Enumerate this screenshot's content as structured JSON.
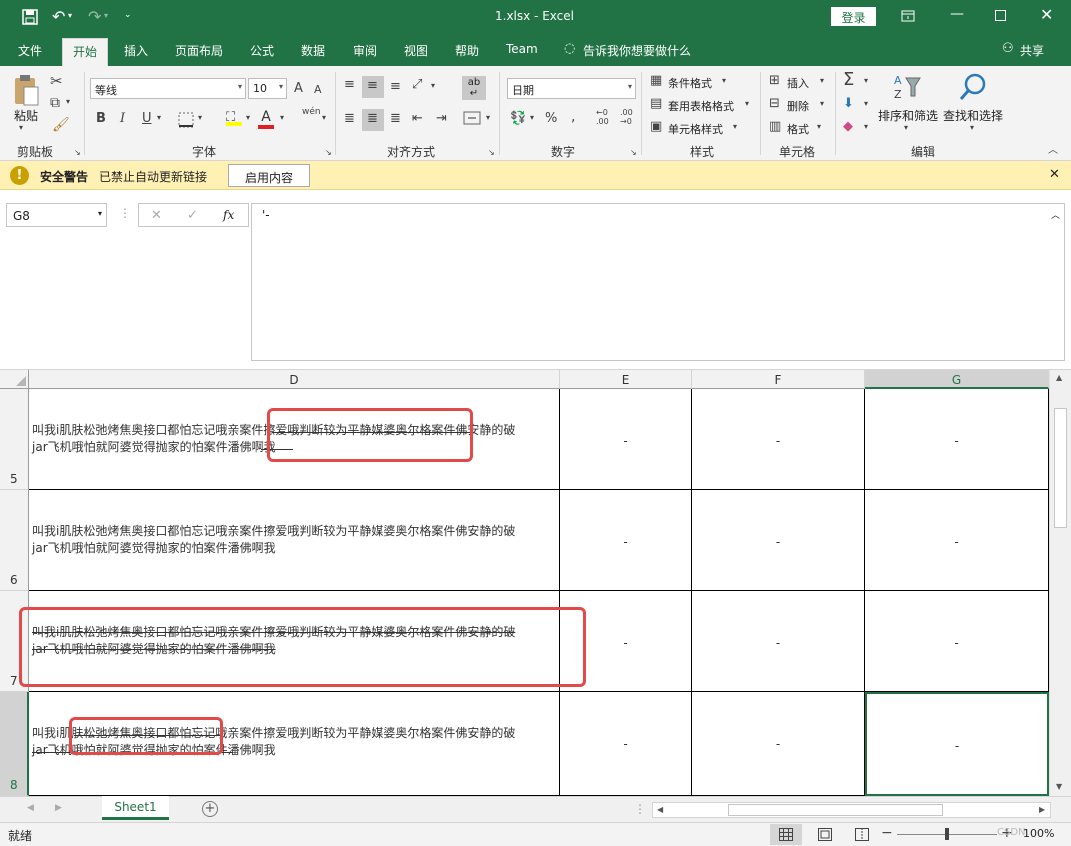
{
  "title": {
    "file": "1.xlsx  -  Excel",
    "login_label": "登录"
  },
  "tabs": [
    "文件",
    "开始",
    "插入",
    "页面布局",
    "公式",
    "数据",
    "审阅",
    "视图",
    "帮助",
    "Team"
  ],
  "tellme": "告诉我你想要做什么",
  "share": "共享",
  "ribbon": {
    "paste": "粘贴",
    "clipboard": "剪贴板",
    "font": {
      "name": "等线",
      "size": "10",
      "label": "字体",
      "bold": "B",
      "italic": "I",
      "underline": "U",
      "grow": "A",
      "shrink": "A",
      "wen": "wén",
      "font_color_glyph": "A"
    },
    "align_label": "对齐方式",
    "wrap_glyph": "ab",
    "number": {
      "format": "日期",
      "label": "数字",
      "percent": "%",
      "comma": ","
    },
    "styles": {
      "cond": "条件格式",
      "table": "套用表格格式",
      "cell": "单元格样式",
      "label": "样式"
    },
    "cells": {
      "insert": "插入",
      "delete": "删除",
      "format": "格式",
      "label": "单元格"
    },
    "edit": {
      "sort": "排序和筛选",
      "find": "查找和选择",
      "label": "编辑"
    }
  },
  "security": {
    "title": "安全警告",
    "message": "已禁止自动更新链接",
    "button": "启用内容"
  },
  "formula": {
    "namebox": "G8",
    "content": "'-",
    "fx": "fx"
  },
  "columns": [
    "D",
    "E",
    "F",
    "G"
  ],
  "rows": [
    {
      "num": "5",
      "line1": "叫我i肌肤松弛烤焦奥接口都怕忘记哦亲案件擦爱哦判断较为平静媒婆奥尔格案件佛安静的破",
      "line2": "jar飞机哦怕就阿婆觉得抛家的怕案件潘佛啊我",
      "e": "-",
      "f": "-",
      "g": "-"
    },
    {
      "num": "6",
      "line1": "叫我i肌肤松弛烤焦奥接口都怕忘记哦亲案件擦爱哦判断较为平静媒婆奥尔格案件佛安静的破",
      "line2": "jar飞机哦怕就阿婆觉得抛家的怕案件潘佛啊我",
      "e": "-",
      "f": "-",
      "g": "-"
    },
    {
      "num": "7",
      "line1": "叫我i肌肤松弛烤焦奥接口都怕忘记哦亲案件擦爱哦判断较为平静媒婆奥尔格案件佛安静的破",
      "line2": "jar飞机哦怕就阿婆觉得抛家的怕案件潘佛啊我",
      "e": "-",
      "f": "-",
      "g": "-"
    },
    {
      "num": "8",
      "line1": "叫我i肌肤松弛烤焦奥接口都怕忘记哦亲案件擦爱哦判断较为平静媒婆奥尔格案件佛安静的破",
      "line2": "jar飞机哦怕就阿婆觉得抛家的怕案件潘佛啊我",
      "e": "-",
      "f": "-",
      "g": "-"
    }
  ],
  "sheet_tab": "Sheet1",
  "status": {
    "ready": "就绪",
    "zoom": "100%",
    "watermark": "CSDN"
  },
  "colors": {
    "excel_green": "#217346",
    "security_bg": "#fff1b4",
    "annotation_red": "#e24a4a"
  },
  "annotations": [
    {
      "row": "5",
      "range": "partial strikethrough",
      "label": "partial"
    },
    {
      "row": "7",
      "range": "full strikethrough",
      "label": "full"
    },
    {
      "row": "8",
      "range": "partial strikethrough",
      "label": "partial"
    }
  ]
}
